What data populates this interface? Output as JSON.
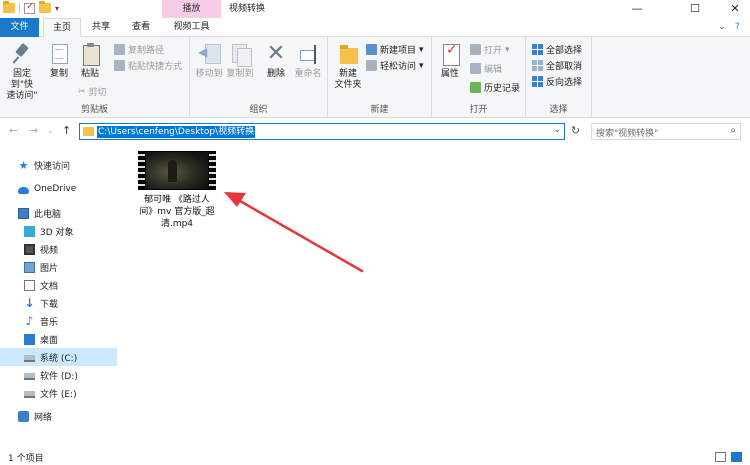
{
  "window": {
    "context_tab": "播放",
    "title": "视频转换",
    "minimize": "—",
    "maximize": "☐",
    "close": "✕"
  },
  "tabs": {
    "file": "文件",
    "home": "主页",
    "share": "共享",
    "view": "查看",
    "video_tools": "视频工具",
    "expand": "⌄",
    "help": "?"
  },
  "ribbon": {
    "clipboard": {
      "pin": "固定到快速访问",
      "pin_line1": "固定到\"快",
      "pin_line2": "速访问\"",
      "copy": "复制",
      "paste": "粘贴",
      "copy_path": "复制路径",
      "paste_shortcut": "粘贴快捷方式",
      "cut": "剪切",
      "label": "剪贴板"
    },
    "organize": {
      "move_to": "移动到",
      "copy_to": "复制到",
      "delete": "删除",
      "rename": "重命名",
      "label": "组织"
    },
    "new": {
      "new_folder_line1": "新建",
      "new_folder_line2": "文件夹",
      "new_item": "新建项目",
      "easy_access": "轻松访问",
      "label": "新建"
    },
    "open": {
      "properties": "属性",
      "open": "打开",
      "edit": "编辑",
      "history": "历史记录",
      "label": "打开"
    },
    "select": {
      "select_all": "全部选择",
      "select_none": "全部取消",
      "invert": "反向选择",
      "label": "选择"
    }
  },
  "address": {
    "path": "C:\\Users\\cenfeng\\Desktop\\视频转换",
    "search_placeholder": "搜索\"视频转换\""
  },
  "nav": {
    "items": [
      {
        "label": "快速访问",
        "icon": "star-icon"
      },
      {
        "label": "OneDrive",
        "icon": "cloud-icon"
      },
      {
        "label": "此电脑",
        "icon": "computer-icon"
      },
      {
        "label": "3D 对象",
        "icon": "cube-icon"
      },
      {
        "label": "视频",
        "icon": "video-icon"
      },
      {
        "label": "图片",
        "icon": "picture-icon"
      },
      {
        "label": "文档",
        "icon": "document-icon"
      },
      {
        "label": "下载",
        "icon": "download-icon"
      },
      {
        "label": "音乐",
        "icon": "music-icon"
      },
      {
        "label": "桌面",
        "icon": "desktop-icon"
      },
      {
        "label": "系统 (C:)",
        "icon": "drive-icon"
      },
      {
        "label": "软件 (D:)",
        "icon": "drive-icon"
      },
      {
        "label": "文件 (E:)",
        "icon": "drive-icon"
      },
      {
        "label": "网络",
        "icon": "network-icon"
      }
    ]
  },
  "files": [
    {
      "name_line1": "郁可唯 《路过人",
      "name_line2": "间》mv 官方版_超",
      "name_line3": "清.mp4",
      "type": "video"
    }
  ],
  "status": {
    "count": "1 个项目"
  },
  "colors": {
    "accent": "#1979ca",
    "context_tab": "#f7cce6",
    "selection": "#cce8ff",
    "arrow": "#e8373a"
  }
}
